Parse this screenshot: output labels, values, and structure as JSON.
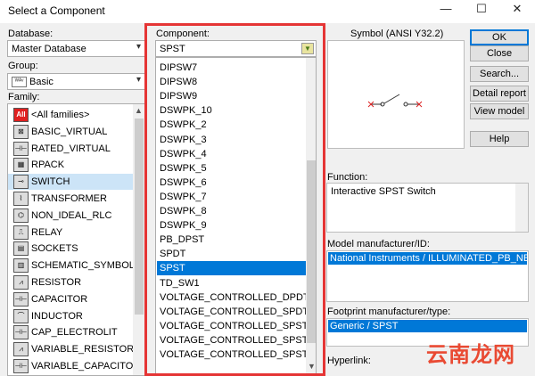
{
  "window": {
    "title": "Select a Component",
    "minimize_glyph": "—",
    "maximize_glyph": "☐",
    "close_glyph": "✕"
  },
  "database": {
    "label": "Database:",
    "value": "Master Database"
  },
  "group": {
    "label": "Group:",
    "value": "Basic",
    "icon_text": "ᵂᴬᵛ"
  },
  "family": {
    "label": "Family:",
    "items": [
      {
        "icon_text": "All",
        "label": "<All families>"
      },
      {
        "icon_text": "⊠",
        "label": "BASIC_VIRTUAL"
      },
      {
        "icon_text": "⊣⊢",
        "label": "RATED_VIRTUAL"
      },
      {
        "icon_text": "▦",
        "label": "RPACK"
      },
      {
        "icon_text": "⊸",
        "label": "SWITCH"
      },
      {
        "icon_text": "⌇",
        "label": "TRANSFORMER"
      },
      {
        "icon_text": "⌬",
        "label": "NON_IDEAL_RLC"
      },
      {
        "icon_text": "⎍",
        "label": "RELAY"
      },
      {
        "icon_text": "▤",
        "label": "SOCKETS"
      },
      {
        "icon_text": "▥",
        "label": "SCHEMATIC_SYMBOLS"
      },
      {
        "icon_text": "⩘",
        "label": "RESISTOR"
      },
      {
        "icon_text": "⊣⊢",
        "label": "CAPACITOR"
      },
      {
        "icon_text": "⌒",
        "label": "INDUCTOR"
      },
      {
        "icon_text": "⊣⊢",
        "label": "CAP_ELECTROLIT"
      },
      {
        "icon_text": "⩘",
        "label": "VARIABLE_RESISTOR"
      },
      {
        "icon_text": "⊣⊢",
        "label": "VARIABLE_CAPACITOR"
      }
    ],
    "selected_index": 4
  },
  "component": {
    "label": "Component:",
    "search_value": "SPST",
    "items": [
      "DIPSW7",
      "DIPSW8",
      "DIPSW9",
      "DSWPK_10",
      "DSWPK_2",
      "DSWPK_3",
      "DSWPK_4",
      "DSWPK_5",
      "DSWPK_6",
      "DSWPK_7",
      "DSWPK_8",
      "DSWPK_9",
      "PB_DPST",
      "SPDT",
      "SPST",
      "TD_SW1",
      "VOLTAGE_CONTROLLED_DPDT",
      "VOLTAGE_CONTROLLED_SPDT",
      "VOLTAGE_CONTROLLED_SPST",
      "VOLTAGE_CONTROLLED_SPST_ANIMA",
      "VOLTAGE_CONTROLLED_SPST_BOUNC"
    ],
    "selected_index": 14
  },
  "symbol": {
    "label": "Symbol (ANSI Y32.2)"
  },
  "buttons": {
    "ok": "OK",
    "close": "Close",
    "search": "Search...",
    "detail_report": "Detail report",
    "view_model": "View model",
    "help": "Help"
  },
  "function": {
    "label": "Function:",
    "value": "Interactive SPST Switch"
  },
  "model_mfr": {
    "label": "Model manufacturer/ID:",
    "value": "National Instruments / ILLUMINATED_PB_NEW"
  },
  "footprint": {
    "label": "Footprint manufacturer/type:",
    "value": "Generic / SPST"
  },
  "hyperlink": {
    "label": "Hyperlink:"
  },
  "watermark": {
    "text": "云南龙网"
  },
  "colors": {
    "highlight": "#0078d7",
    "red_frame": "#e53535",
    "watermark": "#e94a33"
  },
  "icons": {
    "dropdown": "chevron-down-icon",
    "filter": "filter-icon",
    "scroll_up": "chevron-up-icon"
  }
}
